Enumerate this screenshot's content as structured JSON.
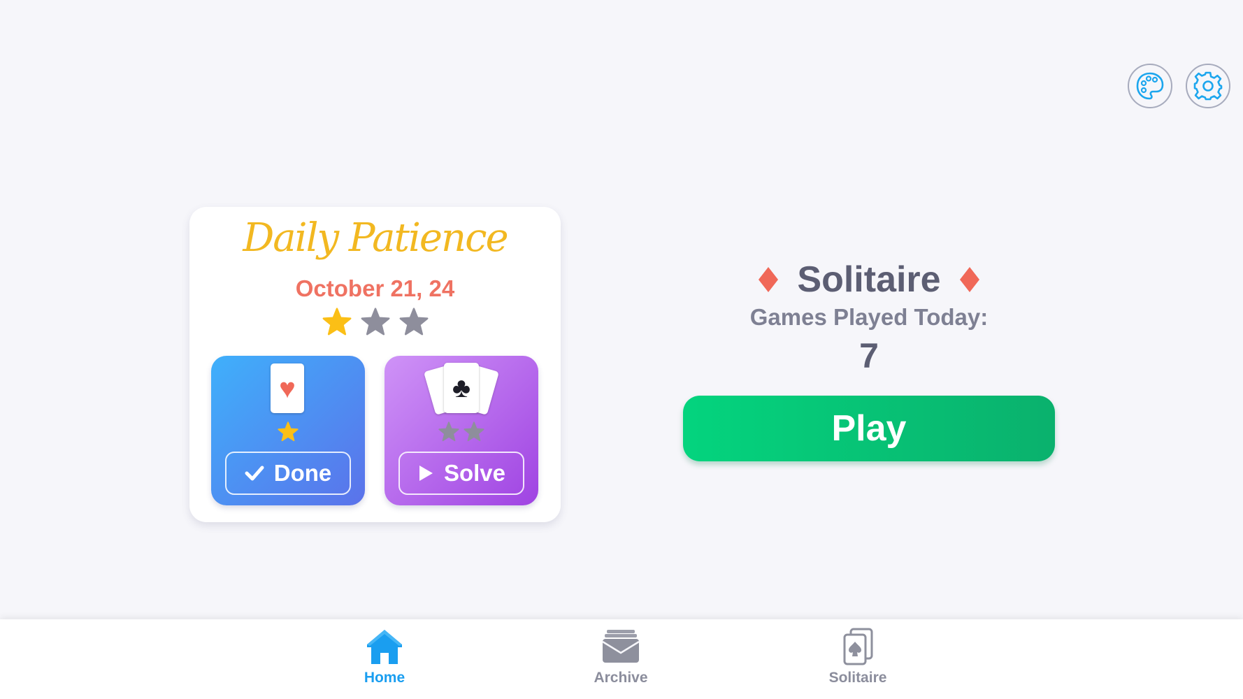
{
  "top_bar": {
    "palette_icon": "palette-icon",
    "settings_icon": "gear-icon"
  },
  "daily": {
    "title": "Daily Patience",
    "date": "October 21, 24",
    "stars_earned": 1,
    "stars_total": 3,
    "tiles": [
      {
        "card_suit": "♥",
        "card_icon": "heart-card-icon",
        "stars_earned": 1,
        "stars_total": 1,
        "button_label": "Done",
        "button_icon": "checkmark-icon"
      },
      {
        "card_suit": "♣",
        "card_icon": "club-cards-icon",
        "stars_earned": 0,
        "stars_total": 2,
        "button_label": "Solve",
        "button_icon": "play-icon"
      }
    ]
  },
  "solitaire": {
    "title": "Solitaire",
    "games_label": "Games Played Today:",
    "games_count": "7",
    "play_label": "Play"
  },
  "nav": {
    "items": [
      {
        "label": "Home",
        "icon": "home-icon",
        "active": true
      },
      {
        "label": "Archive",
        "icon": "archive-icon",
        "active": false
      },
      {
        "label": "Solitaire",
        "icon": "spade-card-icon",
        "active": false
      }
    ]
  },
  "colors": {
    "background": "#f6f6fa",
    "accent_yellow": "#f2b821",
    "date_red": "#ef7262",
    "star_gold": "#fbbf16",
    "star_gray": "#8e8e9c",
    "diamond_red": "#f06858",
    "play_green": "#05c676",
    "nav_active": "#1a9ef0",
    "nav_inactive": "#8b8d9c"
  }
}
